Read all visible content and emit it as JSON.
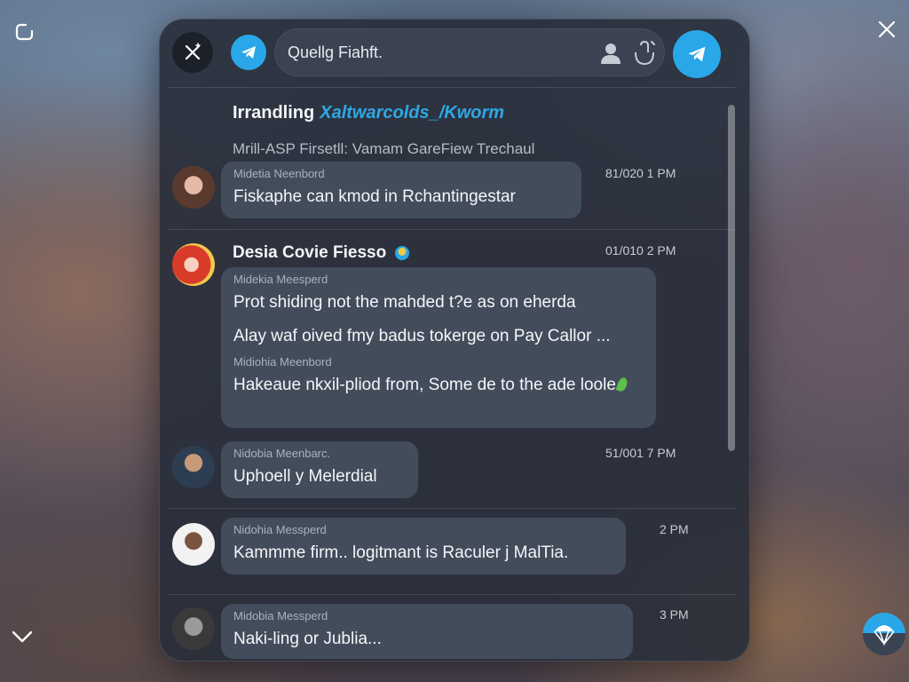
{
  "search": {
    "value": "Quellg Fiahft."
  },
  "header": {
    "title": "Irrandling",
    "title_accent": "Xaltwarcolds_/Kworm",
    "subtitle": "Mrill-ASP Firsetll: Vamam GareFiew Trechaul"
  },
  "messages": [
    {
      "sender": "Midetia Neenbord",
      "text": [
        "Fiskaphe can kmod in Rchantingestar"
      ],
      "time": "81/020 1 PM"
    },
    {
      "contact_name": "Desia Covie Fiesso",
      "time": "01/010 2 PM",
      "sender": "Midekia Meesperd",
      "text": [
        "Prot shiding not the mahded t?e as on eherda",
        "Alay waf oived fmy badus tokerge on Pay Callor ..."
      ],
      "sender2": "Midiohia Meenbord",
      "text2": "Hakeaue nkxil-pliod from, Some de to the ade loole"
    },
    {
      "sender": "Nidobia Meenbarc.",
      "text": [
        "Uphoell y Melerdial"
      ],
      "time": "51/001 7 PM"
    },
    {
      "sender": "Nidohia Messperd",
      "text": [
        "Kammme firm.. logitmant is Raculer j MalTia."
      ],
      "time": "2 PM"
    },
    {
      "sender": "Midobia Messperd",
      "text": [
        "Naki-ling or Jublia..."
      ],
      "time": "3 PM"
    }
  ],
  "colors": {
    "accent": "#2aa7e8",
    "panel": "#282e3a",
    "bubble": "#434c5b"
  },
  "icons": {
    "corner_tl": "square-rounded-icon",
    "corner_tr": "close-icon",
    "corner_bl": "chevron-down-icon",
    "corner_br": "parachute-icon",
    "close": "close-sparkle-icon",
    "telegram": "telegram-icon",
    "user": "user-icon",
    "mic": "microphone-icon",
    "send": "send-icon"
  }
}
